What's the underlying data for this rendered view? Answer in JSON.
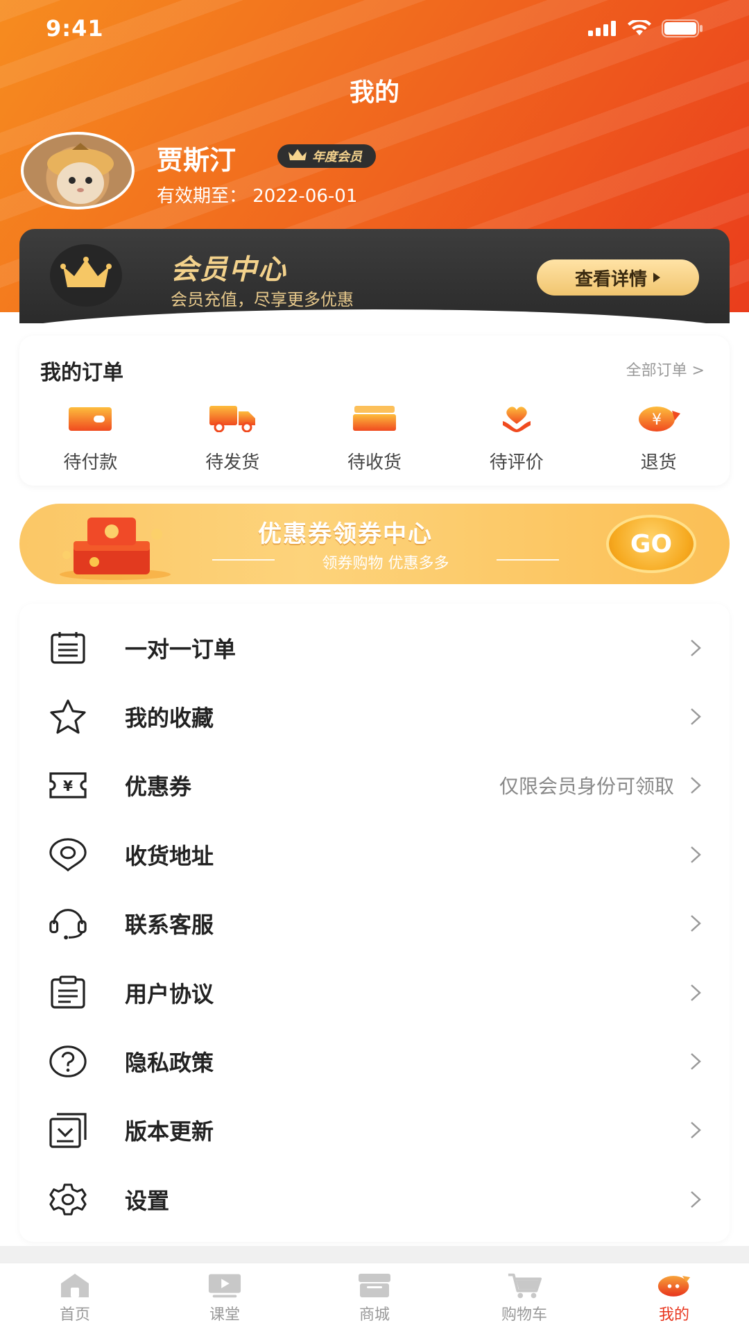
{
  "status_bar": {
    "time": "9:41"
  },
  "header": {
    "title": "我的"
  },
  "user": {
    "name": "贾斯汀",
    "badge": "年度会员",
    "expiry": "有效期至：  2022-06-01"
  },
  "member_card": {
    "title": "会员中心",
    "subtitle": "会员充值，尽享更多优惠",
    "button": "查看详情"
  },
  "orders": {
    "title": "我的订单",
    "all_label": "全部订单 >",
    "items": [
      {
        "label": "待付款",
        "icon": "wallet-icon"
      },
      {
        "label": "待发货",
        "icon": "truck-icon"
      },
      {
        "label": "待收货",
        "icon": "box-icon"
      },
      {
        "label": "待评价",
        "icon": "heart-hand-icon"
      },
      {
        "label": "退货",
        "icon": "refund-icon"
      }
    ]
  },
  "coupon_banner": {
    "title": "优惠券领券中心",
    "subtitle": "领券购物   优惠多多",
    "go": "GO"
  },
  "menu": [
    {
      "label": "一对一订单",
      "icon": "calendar-icon",
      "hint": ""
    },
    {
      "label": "我的收藏",
      "icon": "star-icon",
      "hint": ""
    },
    {
      "label": "优惠券",
      "icon": "coupon-icon",
      "hint": "仅限会员身份可领取"
    },
    {
      "label": "收货地址",
      "icon": "location-icon",
      "hint": ""
    },
    {
      "label": "联系客服",
      "icon": "headset-icon",
      "hint": ""
    },
    {
      "label": "用户协议",
      "icon": "clipboard-icon",
      "hint": ""
    },
    {
      "label": "隐私政策",
      "icon": "question-icon",
      "hint": ""
    },
    {
      "label": "版本更新",
      "icon": "update-icon",
      "hint": ""
    },
    {
      "label": "设置",
      "icon": "gear-icon",
      "hint": ""
    }
  ],
  "tabbar": [
    {
      "label": "首页",
      "icon": "home-icon"
    },
    {
      "label": "课堂",
      "icon": "play-icon"
    },
    {
      "label": "商城",
      "icon": "store-icon"
    },
    {
      "label": "购物车",
      "icon": "cart-icon"
    },
    {
      "label": "我的",
      "icon": "profile-icon"
    }
  ],
  "colors": {
    "accent": "#e8341c",
    "header_start": "#f68c1f",
    "header_end": "#ea3d1c",
    "gold": "#f3d28c"
  }
}
